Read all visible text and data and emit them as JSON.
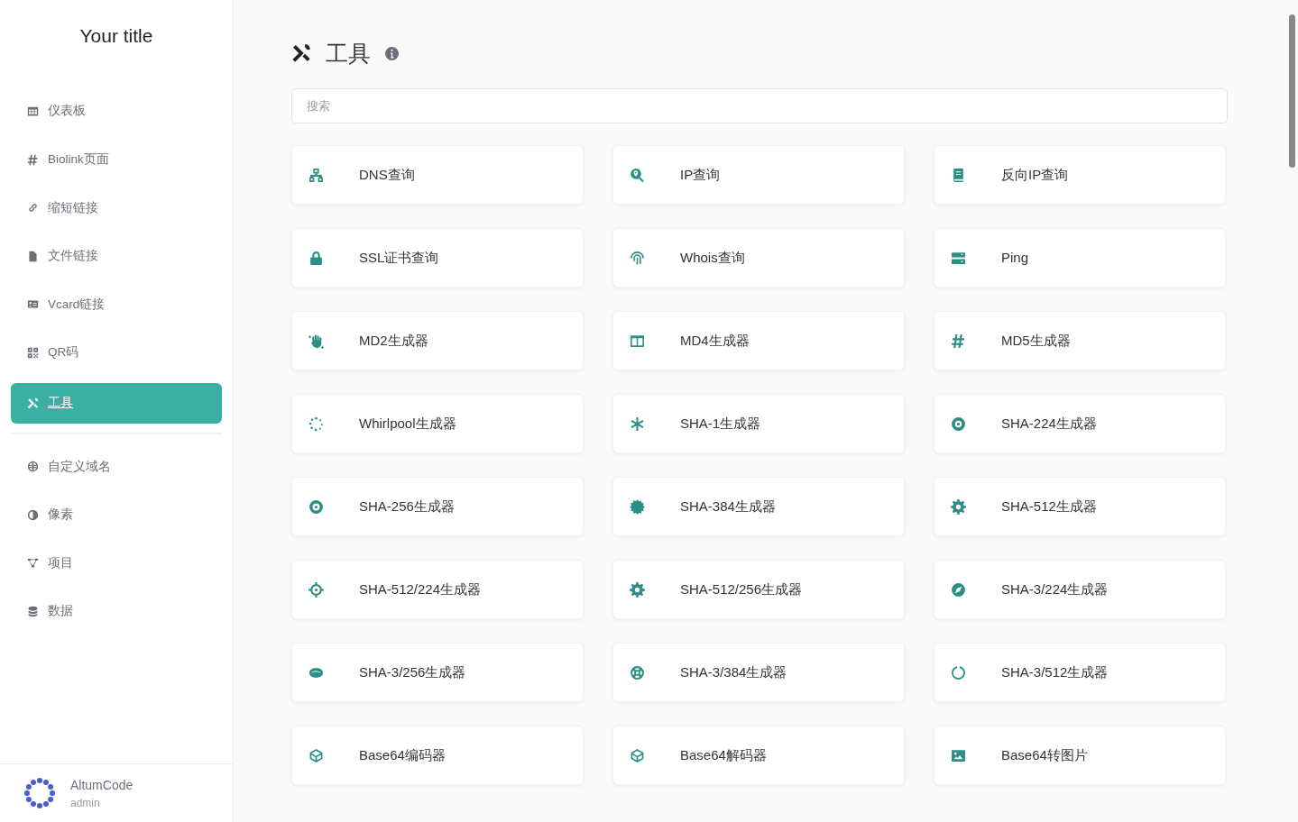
{
  "sidebar": {
    "title": "Your title",
    "items": [
      {
        "label": "仪表板",
        "selected": false
      },
      {
        "label": "Biolink页面",
        "selected": false
      },
      {
        "label": "缩短链接",
        "selected": false
      },
      {
        "label": "文件链接",
        "selected": false
      },
      {
        "label": "Vcard链接",
        "selected": false
      },
      {
        "label": "QR码",
        "selected": false
      },
      {
        "label": "工具",
        "selected": true
      },
      {
        "label": "自定义域名",
        "selected": false
      },
      {
        "label": "像素",
        "selected": false
      },
      {
        "label": "项目",
        "selected": false
      },
      {
        "label": "数据",
        "selected": false
      }
    ],
    "user": {
      "name": "AltumCode",
      "role": "admin"
    }
  },
  "page": {
    "title": "工具",
    "search": {
      "placeholder": "搜索"
    },
    "tools": [
      {
        "label": "DNS查询"
      },
      {
        "label": "IP查询"
      },
      {
        "label": "反向IP查询"
      },
      {
        "label": "SSL证书查询"
      },
      {
        "label": "Whois查询"
      },
      {
        "label": "Ping"
      },
      {
        "label": "MD2生成器"
      },
      {
        "label": "MD4生成器"
      },
      {
        "label": "MD5生成器"
      },
      {
        "label": "Whirlpool生成器"
      },
      {
        "label": "SHA-1生成器"
      },
      {
        "label": "SHA-224生成器"
      },
      {
        "label": "SHA-256生成器"
      },
      {
        "label": "SHA-384生成器"
      },
      {
        "label": "SHA-512生成器"
      },
      {
        "label": "SHA-512/224生成器"
      },
      {
        "label": "SHA-512/256生成器"
      },
      {
        "label": "SHA-3/224生成器"
      },
      {
        "label": "SHA-3/256生成器"
      },
      {
        "label": "SHA-3/384生成器"
      },
      {
        "label": "SHA-3/512生成器"
      },
      {
        "label": "Base64编码器"
      },
      {
        "label": "Base64解码器"
      },
      {
        "label": "Base64转图片"
      }
    ]
  }
}
